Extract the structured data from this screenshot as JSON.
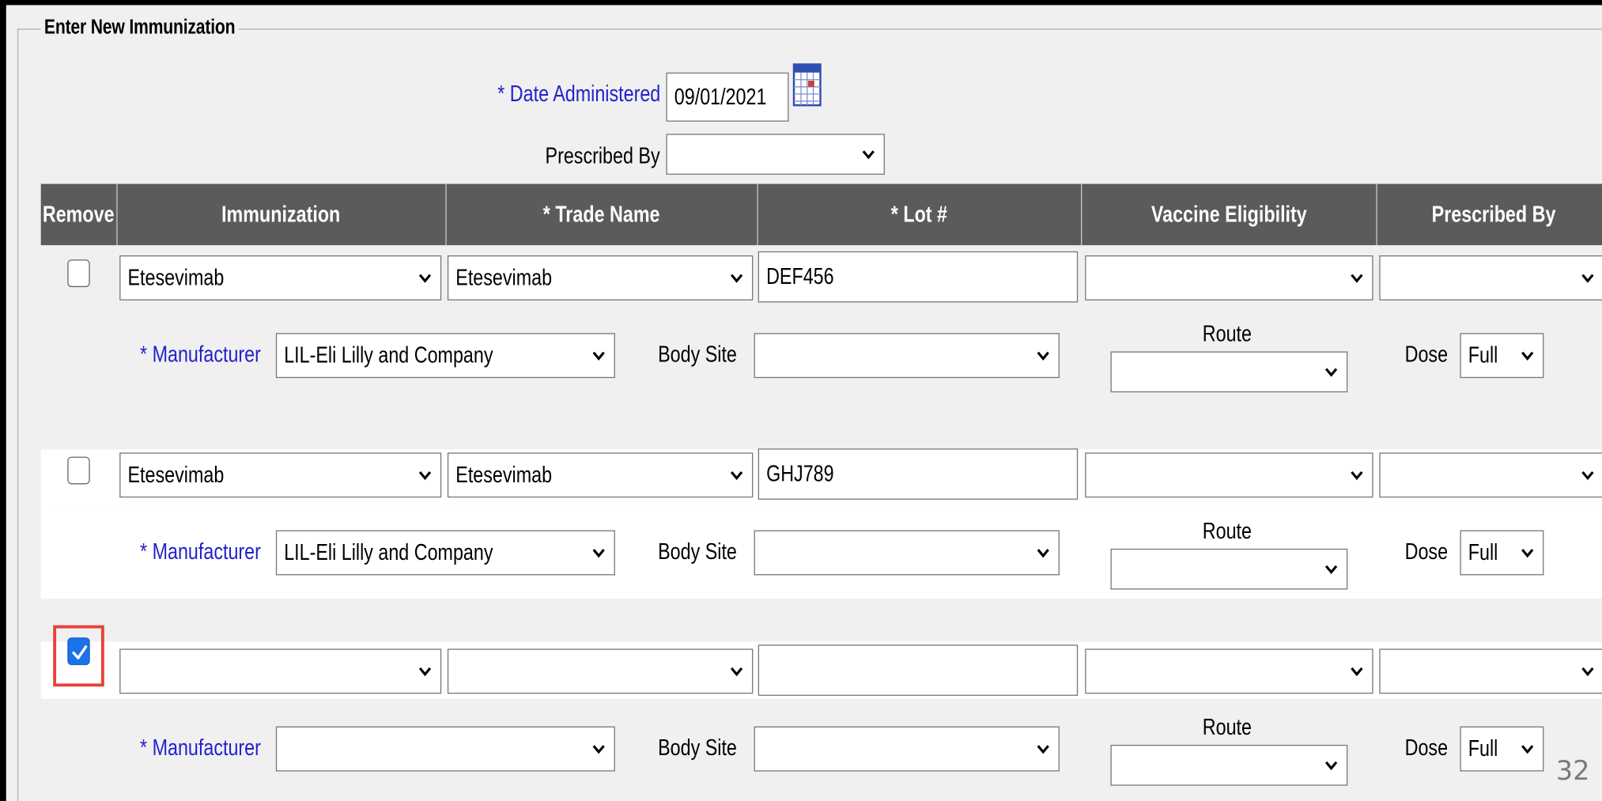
{
  "form": {
    "legend": "Enter New Immunization",
    "date_label": "* Date Administered",
    "date_value": "09/01/2021",
    "prescribed_label": "Prescribed By",
    "prescribed_value": ""
  },
  "table": {
    "headers": [
      "Remove",
      "Immunization",
      "* Trade Name",
      "* Lot #",
      "Vaccine Eligibility",
      "Prescribed By"
    ],
    "detail_labels": {
      "manufacturer": "* Manufacturer",
      "body_site": "Body Site",
      "route": "Route",
      "dose": "Dose"
    },
    "rows": [
      {
        "remove_checked": false,
        "immunization": "Etesevimab",
        "trade_name": "Etesevimab",
        "lot": "DEF456",
        "eligibility": "",
        "prescribed_by": "",
        "manufacturer": "LIL-Eli Lilly and Company",
        "body_site": "",
        "route": "",
        "dose": "Full"
      },
      {
        "remove_checked": false,
        "immunization": "Etesevimab",
        "trade_name": "Etesevimab",
        "lot": "GHJ789",
        "eligibility": "",
        "prescribed_by": "",
        "manufacturer": "LIL-Eli Lilly and Company",
        "body_site": "",
        "route": "",
        "dose": "Full"
      },
      {
        "remove_checked": true,
        "immunization": "",
        "trade_name": "",
        "lot": "",
        "eligibility": "",
        "prescribed_by": "",
        "manufacturer": "",
        "body_site": "",
        "route": "",
        "dose": "Full"
      }
    ]
  },
  "slide_number": "32",
  "colors": {
    "header_bg": "#5b5b5b",
    "required_label": "#2222cc",
    "highlight": "#e8413a",
    "checkbox_checked": "#1a73e8"
  },
  "icons": {
    "calendar": "calendar-icon",
    "dropdown": "chevron-down-icon",
    "checkmark": "checkmark-icon"
  }
}
